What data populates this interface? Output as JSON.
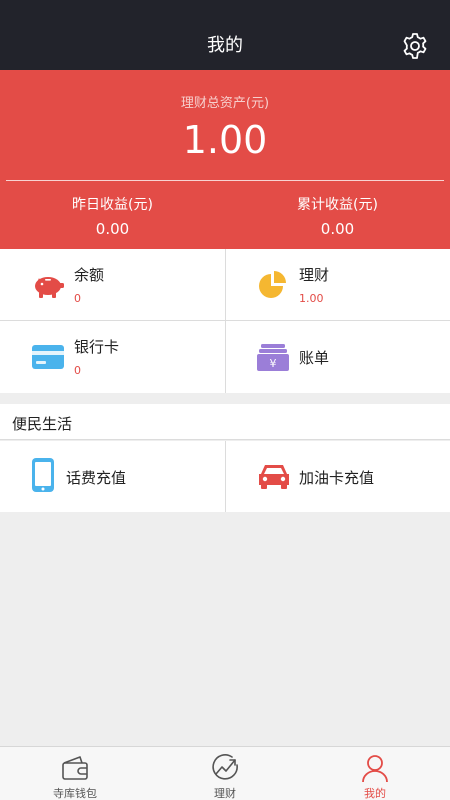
{
  "header": {
    "title": "我的",
    "settings_icon": "gear-icon"
  },
  "summary": {
    "total_label": "理财总资产(元)",
    "total_value": "1.00",
    "yesterday_label": "昨日收益(元)",
    "yesterday_value": "0.00",
    "cumulative_label": "累计收益(元)",
    "cumulative_value": "0.00",
    "accent_color": "#e34c47"
  },
  "assets": [
    {
      "label": "余额",
      "value": "0",
      "icon": "piggy-bank-icon"
    },
    {
      "label": "理财",
      "value": "1.00",
      "icon": "pie-chart-icon"
    },
    {
      "label": "银行卡",
      "value": "0",
      "icon": "bank-card-icon"
    },
    {
      "label": "账单",
      "value": "",
      "icon": "bill-icon"
    }
  ],
  "services": {
    "title": "便民生活",
    "items": [
      {
        "label": "话费充值",
        "icon": "phone-icon"
      },
      {
        "label": "加油卡充值",
        "icon": "car-icon"
      }
    ]
  },
  "tabbar": {
    "items": [
      {
        "label": "寺库钱包",
        "icon": "wallet-icon"
      },
      {
        "label": "理财",
        "icon": "trend-chart-icon"
      },
      {
        "label": "我的",
        "icon": "user-icon"
      }
    ],
    "active": "我的",
    "active_color": "#e34c47"
  }
}
